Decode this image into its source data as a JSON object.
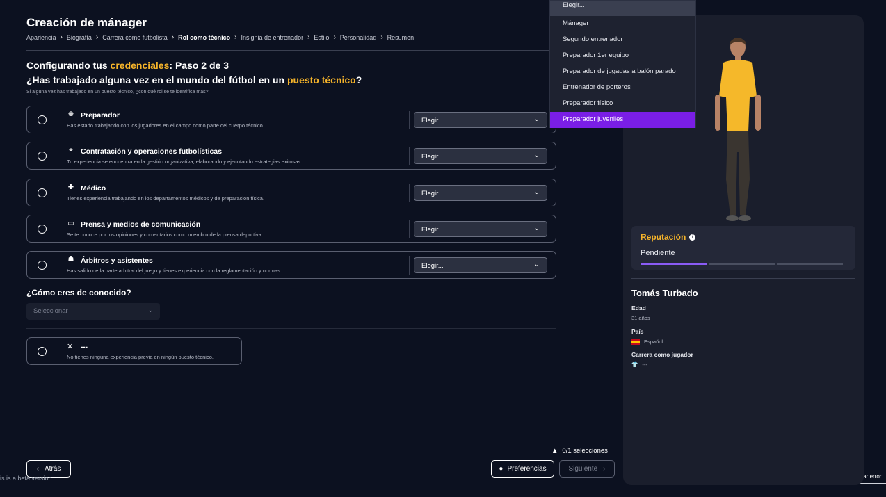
{
  "header": {
    "title": "Creación de mánager",
    "breadcrumb": [
      {
        "label": "Apariencia",
        "active": false
      },
      {
        "label": "Biografía",
        "active": false
      },
      {
        "label": "Carrera como futbolista",
        "active": false
      },
      {
        "label": "Rol como técnico",
        "active": true
      },
      {
        "label": "Insignia de entrenador",
        "active": false
      },
      {
        "label": "Estilo",
        "active": false
      },
      {
        "label": "Personalidad",
        "active": false
      },
      {
        "label": "Resumen",
        "active": false
      }
    ]
  },
  "step": {
    "prefix": "Configurando tus ",
    "highlight": "credenciales",
    "suffix": ": Paso 2 de 3"
  },
  "question": {
    "prefix": "¿Has trabajado alguna vez en el mundo del fútbol en un ",
    "highlight": "puesto técnico",
    "suffix": "?",
    "hint": "Si alguna vez has trabajado en un puesto técnico, ¿con qué rol se te identifica más?"
  },
  "options": [
    {
      "icon": "coach-icon",
      "glyph": "♚",
      "title": "Preparador",
      "desc": "Has estado trabajando con los jugadores en el campo como parte del cuerpo técnico.",
      "select": "Elegir..."
    },
    {
      "icon": "binoculars-icon",
      "glyph": "⚭",
      "title": "Contratación y operaciones futbolísticas",
      "desc": "Tu experiencia se encuentra en la gestión organizativa, elaborando y ejecutando estrategias exitosas.",
      "select": "Elegir..."
    },
    {
      "icon": "medical-bag-icon",
      "glyph": "✚",
      "title": "Médico",
      "desc": "Tienes experiencia trabajando en los departamentos médicos y de preparación física.",
      "select": "Elegir..."
    },
    {
      "icon": "monitor-icon",
      "glyph": "▭",
      "title": "Prensa y medios de comunicación",
      "desc": "Se te conoce por tus opiniones y comentarios como miembro de la prensa deportiva.",
      "select": "Elegir..."
    },
    {
      "icon": "whistle-icon",
      "glyph": "☗",
      "title": "Árbitros y asistentes",
      "desc": "Has salido de la parte arbitral del juego y tienes experiencia con la reglamentación y normas.",
      "select": "Elegir..."
    }
  ],
  "known": {
    "label": "¿Cómo eres de conocido?",
    "placeholder": "Seleccionar"
  },
  "none_option": {
    "title": "---",
    "desc": "No tienes ninguna experiencia previa en ningún puesto técnico."
  },
  "footer": {
    "back": "Atrás",
    "beta": "is is a beta version",
    "count": "0/1 selecciones",
    "preferences": "Preferencias",
    "next": "Siguiente",
    "report": "Notificar error"
  },
  "dropdown": {
    "items": [
      {
        "label": "Elegir...",
        "state": "header"
      },
      {
        "label": "Mánager",
        "state": "normal"
      },
      {
        "label": "Segundo entrenador",
        "state": "normal"
      },
      {
        "label": "Preparador 1er equipo",
        "state": "normal"
      },
      {
        "label": "Preparador de jugadas a balón parado",
        "state": "normal"
      },
      {
        "label": "Entrenador de porteros",
        "state": "normal"
      },
      {
        "label": "Preparador físico",
        "state": "normal"
      },
      {
        "label": "Preparador juveniles",
        "state": "selected"
      }
    ]
  },
  "profile": {
    "reputation_label": "Reputación",
    "reputation_status": "Pendiente",
    "reputation_filled_segments": 1,
    "reputation_total_segments": 3,
    "name": "Tomás Turbado",
    "age_label": "Edad",
    "age_value": "31 años",
    "country_label": "País",
    "country_value": "Español",
    "career_label": "Carrera como jugador",
    "career_value": "---"
  },
  "colors": {
    "background": "#0c1120",
    "accent": "#f6b42a",
    "selected": "#7a1ee6",
    "progress": "#8b5cf6",
    "panel": "#1a1e2c"
  }
}
